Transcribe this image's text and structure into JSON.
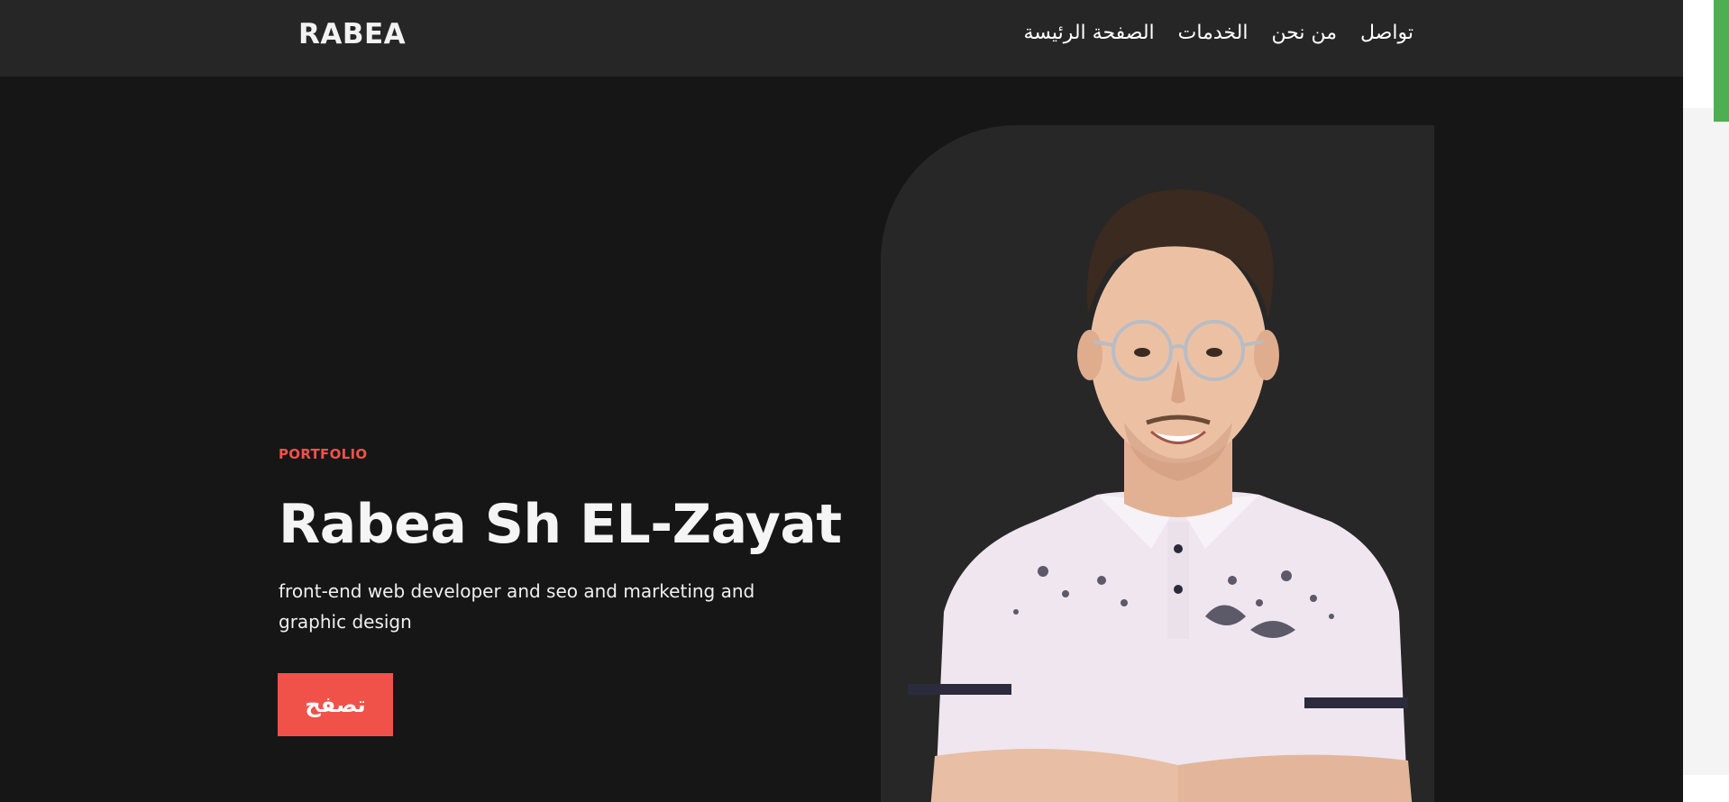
{
  "navbar": {
    "logo": "RABEA",
    "links": [
      {
        "label": "الصفحة الرئيسة"
      },
      {
        "label": "الخدمات"
      },
      {
        "label": "من نحن"
      },
      {
        "label": "تواصل"
      }
    ]
  },
  "hero": {
    "eyebrow": "PORTFOLIO",
    "title": "Rabea Sh EL-Zayat",
    "description": "front-end web developer and seo and marketing and graphic design",
    "cta_label": "تصفح"
  },
  "colors": {
    "page_background": "#161617",
    "navbar_background": "#262627",
    "accent": "#f0524a",
    "photo_panel": "#272728",
    "scroll_thumb": "#4caf50"
  },
  "icons": {
    "portrait": "person-photo"
  }
}
